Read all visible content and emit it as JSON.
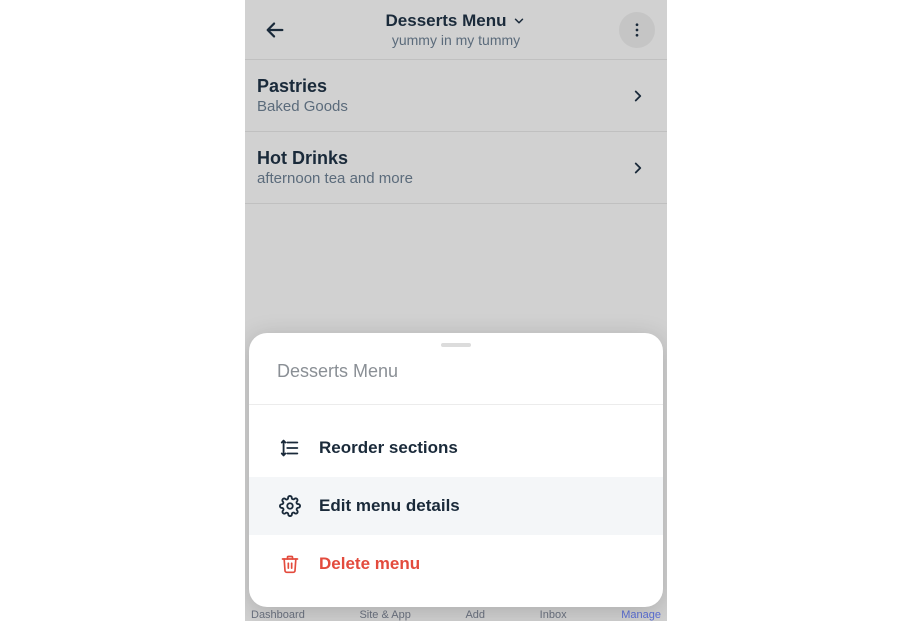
{
  "header": {
    "title": "Desserts Menu",
    "subtitle": "yummy in my tummy"
  },
  "sections": [
    {
      "title": "Pastries",
      "subtitle": "Baked Goods"
    },
    {
      "title": "Hot Drinks",
      "subtitle": "afternoon tea and more"
    }
  ],
  "sheet": {
    "title": "Desserts Menu",
    "options": {
      "reorder": "Reorder sections",
      "edit": "Edit menu details",
      "delete": "Delete menu"
    }
  },
  "bottom_nav": {
    "dashboard": "Dashboard",
    "site": "Site & App",
    "add": "Add",
    "inbox": "Inbox",
    "manage": "Manage"
  }
}
